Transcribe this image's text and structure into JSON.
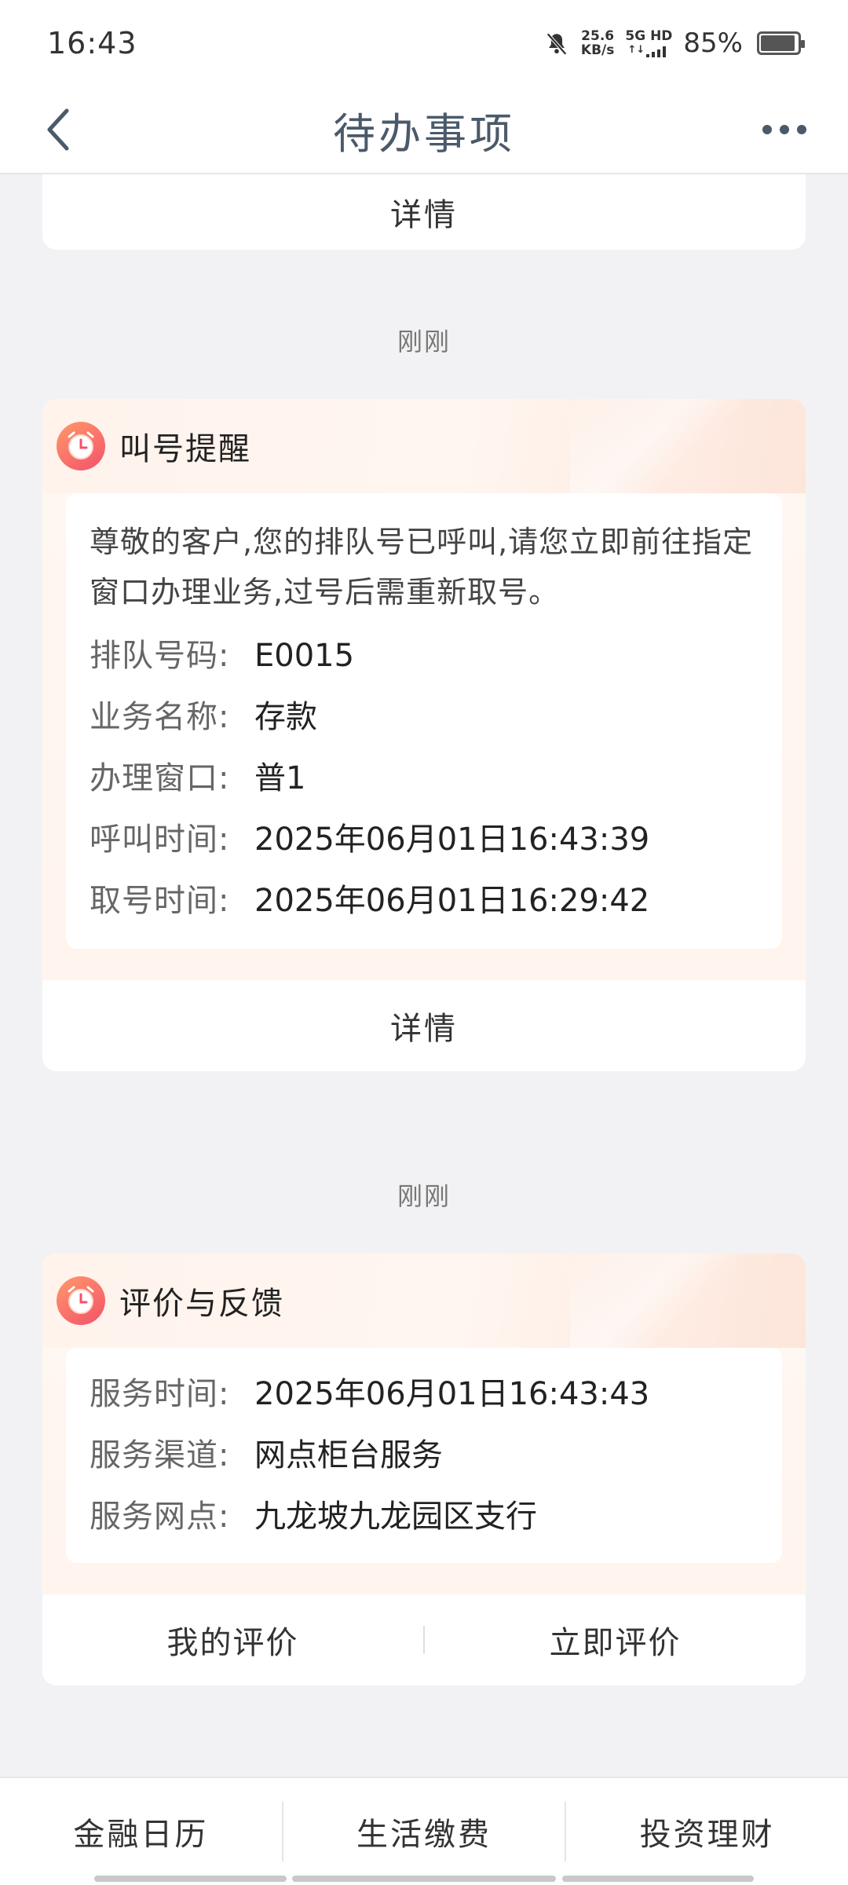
{
  "status_bar": {
    "time": "16:43",
    "net_speed_value": "25.6",
    "net_speed_unit": "KB/s",
    "network_top": "5G HD",
    "network_bottom": "↑↓",
    "battery": "85%",
    "battery_level": 0.85
  },
  "nav": {
    "title": "待办事项",
    "back_icon": "back-arrow-icon",
    "more_icon": "more-dots-icon"
  },
  "top_card": {
    "action": "详情"
  },
  "timestamps": [
    "刚刚",
    "刚刚"
  ],
  "queue_card": {
    "title": "叫号提醒",
    "message": "尊敬的客户,您的排队号已呼叫,请您立即前往指定窗口办理业务,过号后需重新取号。",
    "rows": [
      {
        "label": "排队号码:",
        "value": "E0015"
      },
      {
        "label": "业务名称:",
        "value": "存款"
      },
      {
        "label": "办理窗口:",
        "value": "普1"
      },
      {
        "label": "呼叫时间:",
        "value": "2025年06月01日16:43:39"
      },
      {
        "label": "取号时间:",
        "value": "2025年06月01日16:29:42"
      }
    ],
    "action": "详情"
  },
  "feedback_card": {
    "title": "评价与反馈",
    "rows": [
      {
        "label": "服务时间:",
        "value": "2025年06月01日16:43:43"
      },
      {
        "label": "服务渠道:",
        "value": "网点柜台服务"
      },
      {
        "label": "服务网点:",
        "value": "九龙坡九龙园区支行"
      }
    ],
    "actions": [
      "我的评价",
      "立即评价"
    ]
  },
  "bottom_tabs": [
    "金融日历",
    "生活缴费",
    "投资理财"
  ],
  "colors": {
    "background": "#f2f2f4",
    "title": "#4a5a6a",
    "card_header_tint": "#fff3ec",
    "icon_gradient_start": "#ff9a6a",
    "icon_gradient_end": "#f4506a"
  }
}
